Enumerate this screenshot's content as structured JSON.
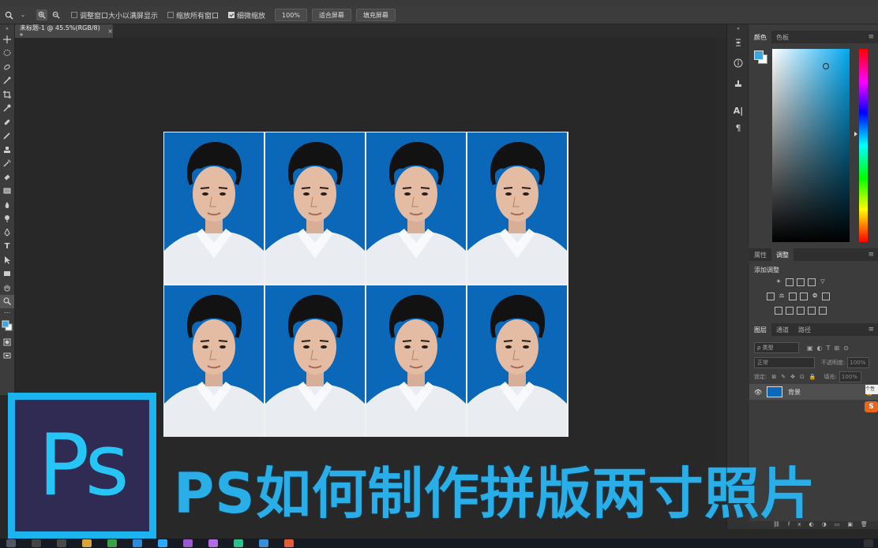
{
  "options_bar": {
    "fit_windows_label": "调整窗口大小以满屏显示",
    "zoom_all_label": "缩放所有窗口",
    "scrubby_label": "细微缩放",
    "zoom_value": "100%",
    "fit_screen_label": "适合屏幕",
    "fill_screen_label": "填充屏幕"
  },
  "document": {
    "tab_title": "未标题-1 @ 45.5%(RGB/8) *",
    "close_glyph": "×"
  },
  "panels": {
    "color_tab": "颜色",
    "swatches_tab": "色板",
    "properties_tab": "属性",
    "adjustments_tab": "调整",
    "add_adjustment_label": "添加调整",
    "layers_tab": "图层",
    "channels_tab": "通道",
    "paths_tab": "路径",
    "kind_filter": "ρ 类型",
    "blend_mode": "正常",
    "opacity_label": "不透明度:",
    "opacity_value": "100%",
    "lock_label": "锁定:",
    "fill_label": "填充:",
    "fill_value": "100%",
    "layer_name": "背景",
    "tooltip_fragment": "个性"
  },
  "overlay": {
    "logo_text": "Ps",
    "headline": "PS如何制作拼版两寸照片"
  },
  "colors": {
    "foreground": "#3aa7e0",
    "photo_background": "#0b67b8",
    "headline": "#29aee8",
    "logo_border": "#1bb4ef",
    "logo_fill": "#2f2b52"
  }
}
